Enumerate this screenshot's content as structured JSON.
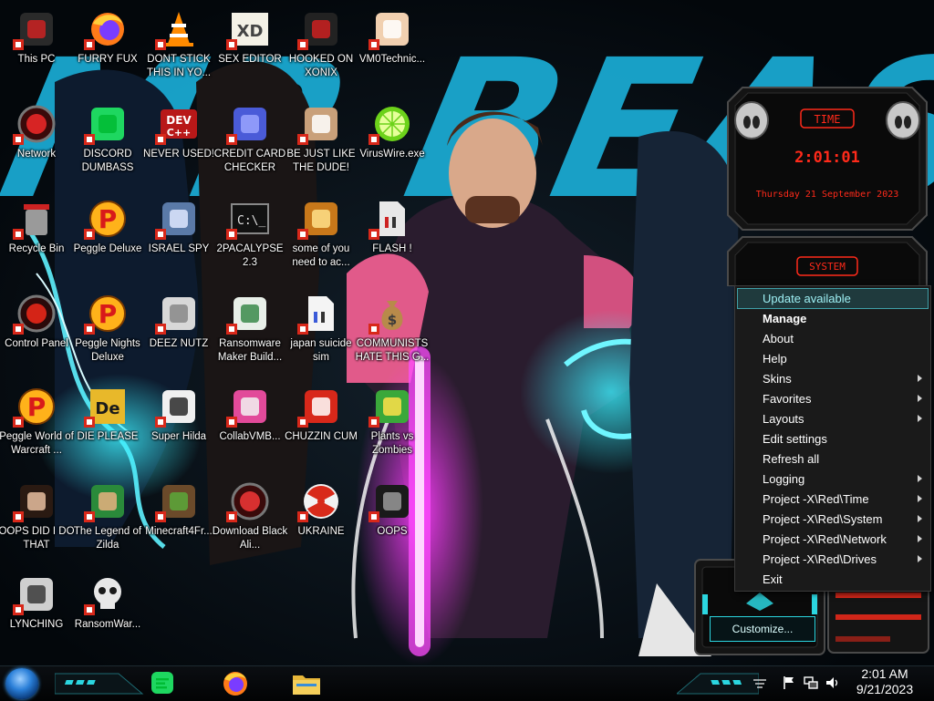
{
  "desktop": {
    "wallpaper_text": "MR BEAST",
    "icons": [
      {
        "label": "This PC",
        "icon": "computer-icon"
      },
      {
        "label": "FURRY FUX",
        "icon": "firefox-icon"
      },
      {
        "label": "DONT STICK THIS IN YO...",
        "icon": "vlc-cone-icon"
      },
      {
        "label": "SEX EDITOR",
        "icon": "xd-editor-icon"
      },
      {
        "label": "HOOKED ON XONIX",
        "icon": "xonix-game-icon"
      },
      {
        "label": "VM0Technic...",
        "icon": "doctor-icon"
      },
      {
        "label": "Network",
        "icon": "network-orb-icon"
      },
      {
        "label": "DISCORD DUMBASS",
        "icon": "chat-icon"
      },
      {
        "label": "NEVER USED!",
        "icon": "dev-cpp-icon"
      },
      {
        "label": "CREDIT CARD CHECKER",
        "icon": "credit-card-icon"
      },
      {
        "label": "BE JUST LIKE THE DUDE!",
        "icon": "old-man-icon"
      },
      {
        "label": "VirusWire.exe",
        "icon": "lime-icon"
      },
      {
        "label": "Recycle Bin",
        "icon": "recycle-bin-icon"
      },
      {
        "label": "Peggle Deluxe",
        "icon": "peggle-icon"
      },
      {
        "label": "ISRAEL SPY",
        "icon": "remote-desktop-icon"
      },
      {
        "label": "2PACALYPSE 2.3",
        "icon": "terminal-icon"
      },
      {
        "label": "some of you need to ac...",
        "icon": "beaver-icon"
      },
      {
        "label": "FLASH !",
        "icon": "flash-doc-icon"
      },
      {
        "label": "Control Panel",
        "icon": "control-panel-icon"
      },
      {
        "label": "Peggle Nights Deluxe",
        "icon": "peggle-icon"
      },
      {
        "label": "DEEZ NUTZ",
        "icon": "windows-stack-icon"
      },
      {
        "label": "Ransomware Maker Build...",
        "icon": "window-app-icon"
      },
      {
        "label": "japan suicide sim",
        "icon": "document-icon"
      },
      {
        "label": "COMMUNISTS HATE THIS G...",
        "icon": "money-bag-icon"
      },
      {
        "label": "Peggle World of Warcraft ...",
        "icon": "peggle-icon"
      },
      {
        "label": "DIE PLEASE",
        "icon": "dreamweaver-icon"
      },
      {
        "label": "Super Hilda",
        "icon": "pixel-cat-icon"
      },
      {
        "label": "CollabVMB...",
        "icon": "monitor-icon"
      },
      {
        "label": "CHUZZIN CUM",
        "icon": "chuzzle-icon"
      },
      {
        "label": "Plants vs Zombies",
        "icon": "plant-icon"
      },
      {
        "label": "OOPS DID I DO THAT",
        "icon": "portrait-icon"
      },
      {
        "label": "The Legend of Zilda",
        "icon": "zelda-icon"
      },
      {
        "label": "Minecraft4Fr...",
        "icon": "minecraft-block-icon"
      },
      {
        "label": "Download Black Ali...",
        "icon": "alien-orb-icon"
      },
      {
        "label": "UKRAINE",
        "icon": "radiation-icon"
      },
      {
        "label": "OOPS",
        "icon": "mirror-icon"
      },
      {
        "label": "LYNCHING",
        "icon": "tux-gear-icon"
      },
      {
        "label": "RansomWar...",
        "icon": "skull-icon"
      }
    ]
  },
  "widgets": {
    "time": {
      "header": "TIME",
      "clock": "2:01:01",
      "date": "Thursday 21 September 2023"
    },
    "system": {
      "header": "SYSTEM"
    }
  },
  "context_menu": {
    "items": [
      {
        "label": "Update available",
        "highlighted": true,
        "bold": false,
        "submenu": false
      },
      {
        "label": "Manage",
        "highlighted": false,
        "bold": true,
        "submenu": false
      },
      {
        "label": "About",
        "highlighted": false,
        "bold": false,
        "submenu": false
      },
      {
        "label": "Help",
        "highlighted": false,
        "bold": false,
        "submenu": false
      },
      {
        "label": "Skins",
        "highlighted": false,
        "bold": false,
        "submenu": true
      },
      {
        "label": "Favorites",
        "highlighted": false,
        "bold": false,
        "submenu": true
      },
      {
        "label": "Layouts",
        "highlighted": false,
        "bold": false,
        "submenu": true
      },
      {
        "label": "Edit settings",
        "highlighted": false,
        "bold": false,
        "submenu": false
      },
      {
        "label": "Refresh all",
        "highlighted": false,
        "bold": false,
        "submenu": false
      },
      {
        "label": "Logging",
        "highlighted": false,
        "bold": false,
        "submenu": true
      },
      {
        "label": "Project -X\\Red\\Time",
        "highlighted": false,
        "bold": false,
        "submenu": true
      },
      {
        "label": "Project -X\\Red\\System",
        "highlighted": false,
        "bold": false,
        "submenu": true
      },
      {
        "label": "Project -X\\Red\\Network",
        "highlighted": false,
        "bold": false,
        "submenu": true
      },
      {
        "label": "Project -X\\Red\\Drives",
        "highlighted": false,
        "bold": false,
        "submenu": true
      },
      {
        "label": "Exit",
        "highlighted": false,
        "bold": false,
        "submenu": false
      }
    ]
  },
  "customize": {
    "button_label": "Customize..."
  },
  "taskbar": {
    "pinned": [
      {
        "name": "chat-app",
        "icon": "chat-icon"
      },
      {
        "name": "firefox",
        "icon": "firefox-icon"
      },
      {
        "name": "file-explorer",
        "icon": "folder-icon"
      }
    ],
    "tray": [
      "flag-icon",
      "network-tray-icon",
      "volume-icon"
    ],
    "clock_time": "2:01 AM",
    "clock_date": "9/21/2023"
  },
  "colors": {
    "accent_cyan": "#2bd6e0",
    "widget_red": "#ff2a1a",
    "menu_bg": "#1a1a1a",
    "menu_highlight": "#1f3a3d"
  }
}
